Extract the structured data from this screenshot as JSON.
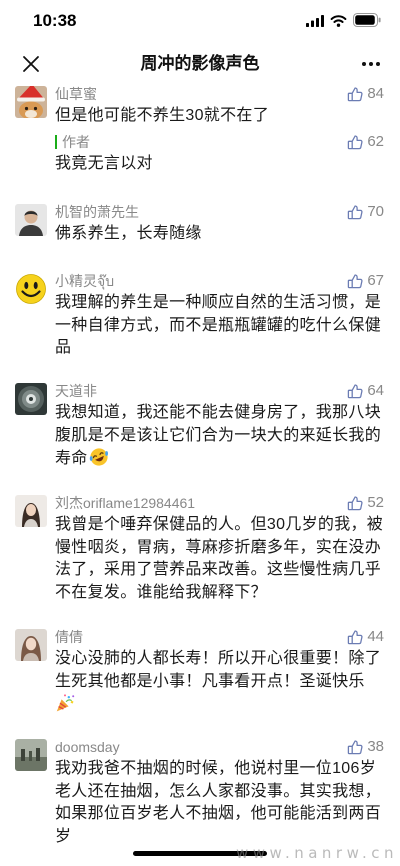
{
  "status_bar": {
    "time": "10:38",
    "signal_icon": "cellular-signal-icon",
    "wifi_icon": "wifi-icon",
    "battery_icon": "battery-icon",
    "battery_level": 0.95
  },
  "header": {
    "title": "周冲的影像声色",
    "close_icon": "close-icon",
    "more_icon": "more-dots-icon"
  },
  "colors": {
    "author_bar": "#1aad19",
    "like_icon": "#6b7cb3",
    "meta_text": "#888888",
    "body_text": "#1a1a1a"
  },
  "comments": [
    {
      "name": "仙草蜜",
      "likes": 84,
      "lines": [
        "但是他可能不养生30就不在了"
      ],
      "reply": {
        "name": "作者",
        "likes": 62,
        "lines": [
          "我竟无言以对"
        ]
      }
    },
    {
      "name": "机智的萧先生",
      "likes": 70,
      "lines": [
        "佛系养生，长寿随缘"
      ]
    },
    {
      "name": "小精灵จุ๊บ",
      "likes": 67,
      "lines": [
        "我理解的养生是一种顺应自然的生活习惯，是",
        "一种自律方式，而不是瓶瓶罐罐的吃什么保健",
        "品"
      ]
    },
    {
      "name": "天道非",
      "likes": 64,
      "lines": [
        "我想知道，我还能不能去健身房了，我那八块",
        "腹肌是不是该让它们合为一块大的来延长我的",
        "寿命"
      ],
      "emoji_icon": "rolling-on-floor-laughing-emoji"
    },
    {
      "name": "刘杰oriflame12984461",
      "likes": 52,
      "lines": [
        "我曾是个唾弃保健品的人。但30几岁的我，被",
        "慢性咽炎，胃病，荨麻疹折磨多年，实在没办",
        "法了，采用了营养品来改善。这些慢性病几乎",
        "不在复发。谁能给我解释下？"
      ]
    },
    {
      "name": "倩倩",
      "likes": 44,
      "lines": [
        "没心没肺的人都长寿！所以开心很重要！除了",
        "生死其他都是小事！凡事看开点！圣诞快乐"
      ],
      "emoji_icon": "party-popper-emoji"
    },
    {
      "name": "doomsday",
      "likes": 38,
      "lines": [
        "我劝我爸不抽烟的时候，他说村里一位106岁",
        "老人还在抽烟，怎么人家都没事。其实我想，",
        "如果那位百岁老人不抽烟，他可能能活到两百",
        "岁"
      ]
    }
  ],
  "watermark": "www.nanrw.cn"
}
